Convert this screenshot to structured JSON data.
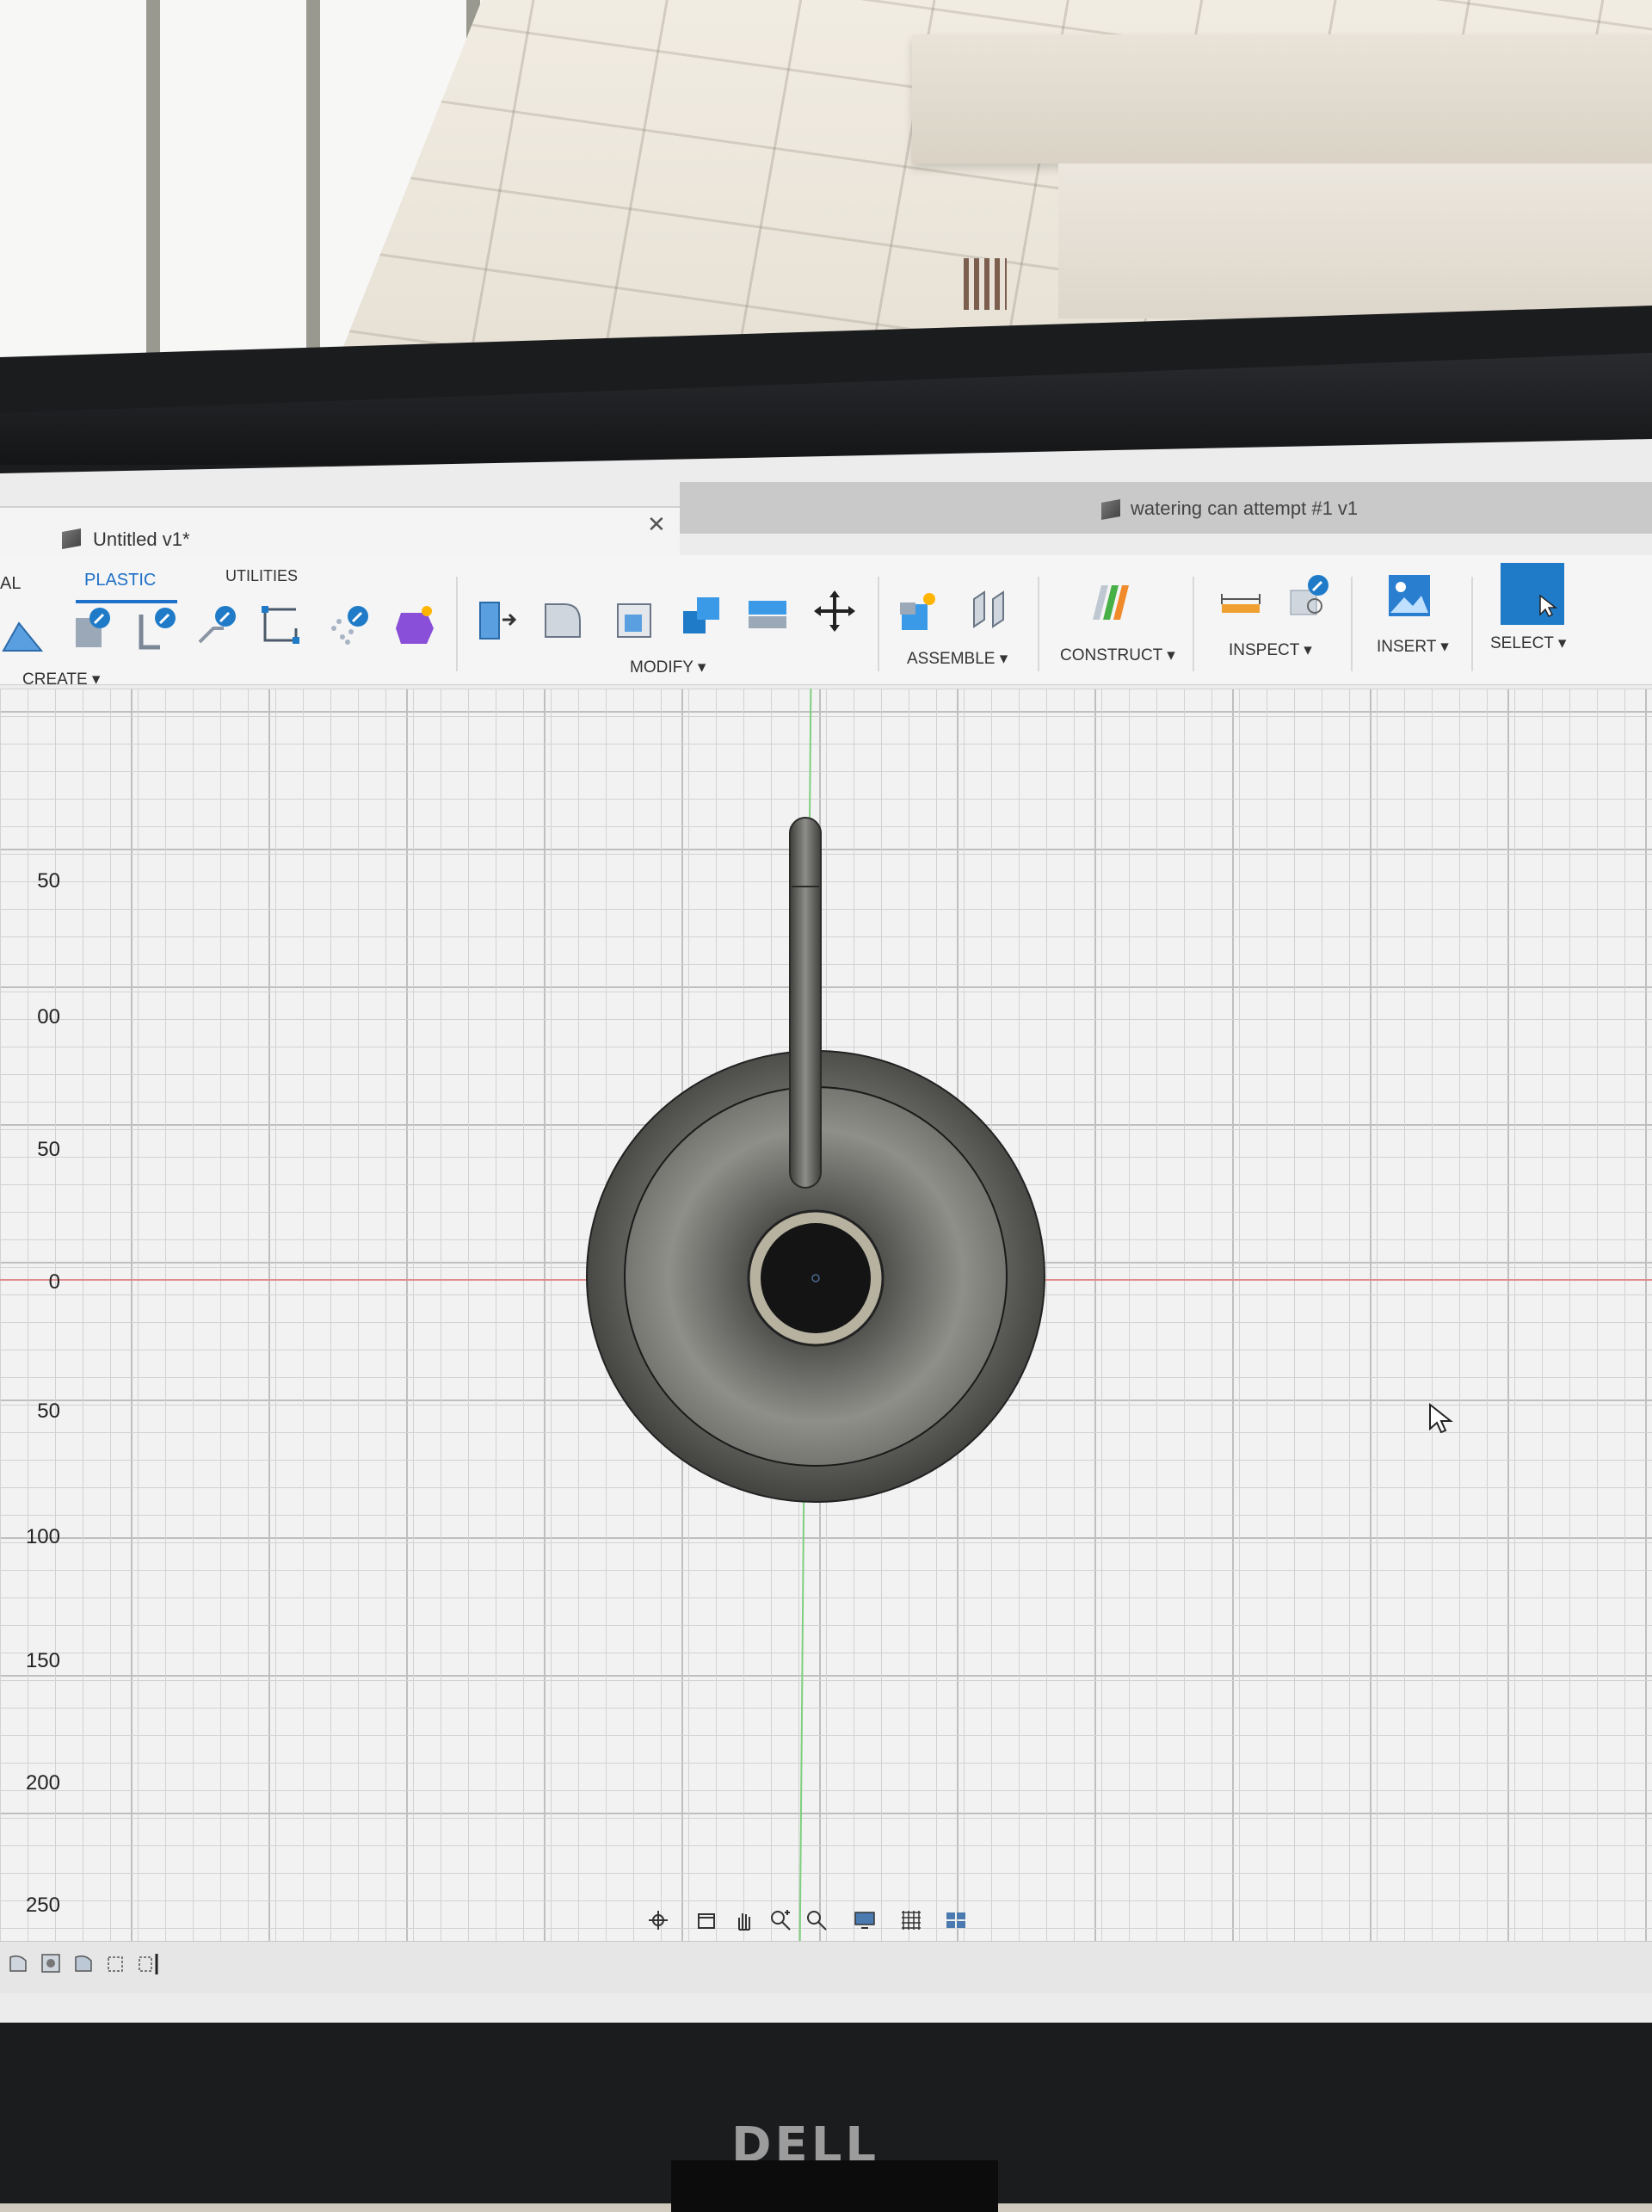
{
  "tabs": {
    "active_title": "Untitled v1*",
    "inactive_title": "watering can attempt #1 v1"
  },
  "workspace_tabs": {
    "partial": "AL",
    "plastic": "PLASTIC",
    "utilities": "UTILITIES"
  },
  "toolbar": {
    "create": "CREATE ▾",
    "modify": "MODIFY ▾",
    "assemble": "ASSEMBLE ▾",
    "construct": "CONSTRUCT ▾",
    "inspect": "INSPECT ▾",
    "insert": "INSERT ▾",
    "select": "SELECT ▾"
  },
  "ruler": {
    "labels": [
      "50",
      "00",
      "50",
      "0",
      "50",
      "100",
      "150",
      "200",
      "250"
    ]
  },
  "brand": "DELL",
  "colors": {
    "accent": "#1f70c8",
    "x_axis": "#e08b8b",
    "y_axis": "#7ecf7e",
    "select_button": "#1f7bc8"
  },
  "icons": {
    "toolbar": [
      "extrude-icon",
      "revolve-icon",
      "rib-icon",
      "web-icon",
      "snap-fit-icon",
      "boss-icon",
      "pattern-icon",
      "form-icon",
      "press-pull-icon",
      "fillet-icon",
      "shell-icon",
      "combine-icon",
      "offset-face-icon",
      "move-icon",
      "new-component-icon",
      "joint-icon",
      "construct-plane-icon",
      "measure-icon",
      "interference-icon",
      "insert-image-icon",
      "select-icon"
    ],
    "navbar": [
      "orbit-icon",
      "look-at-icon",
      "pan-icon",
      "zoom-icon",
      "fit-icon",
      "display-settings-icon",
      "grid-icon",
      "viewports-icon"
    ]
  }
}
